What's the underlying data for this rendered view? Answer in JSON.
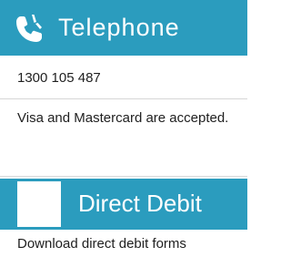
{
  "telephone": {
    "icon": "phone-icon",
    "title": "Telephone",
    "number": "1300 105 487",
    "cards_note": "Visa and Mastercard are accepted."
  },
  "direct_debit": {
    "icon": "blank-square-icon",
    "title": "Direct Debit",
    "download_text": "Download direct debit forms"
  },
  "colors": {
    "header_bg": "#2b9cbe",
    "header_text": "#ffffff",
    "body_text": "#1f1f1f",
    "divider": "#d6d6d6"
  }
}
